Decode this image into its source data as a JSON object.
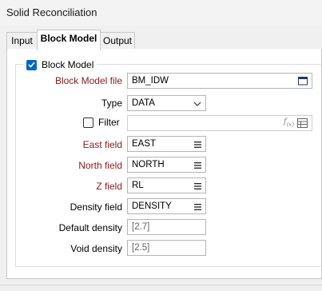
{
  "window": {
    "title": "Solid Reconciliation"
  },
  "tabs": [
    {
      "label": "Input"
    },
    {
      "label": "Block Model"
    },
    {
      "label": "Output"
    }
  ],
  "group": {
    "label": "Block Model",
    "checked": true
  },
  "form": {
    "block_model_file": {
      "label": "Block Model file",
      "value": "BM_IDW"
    },
    "type": {
      "label": "Type",
      "value": "DATA"
    },
    "filter": {
      "label": "Filter",
      "checked": false,
      "value": ""
    },
    "east_field": {
      "label": "East field",
      "value": "EAST"
    },
    "north_field": {
      "label": "North field",
      "value": "NORTH"
    },
    "z_field": {
      "label": "Z field",
      "value": "RL"
    },
    "density_field": {
      "label": "Density field",
      "value": "DENSITY"
    },
    "default_density": {
      "label": "Default density",
      "value": "[2.7]"
    },
    "void_density": {
      "label": "Void density",
      "value": "[2.5]"
    }
  },
  "icons": {
    "file_browse": "calendar-file-icon",
    "dropdown": "chevron-down-icon",
    "list": "list-icon",
    "expression": "fx-icon",
    "filter_table": "table-icon"
  },
  "colors": {
    "accent": "#0067c0",
    "required_label": "#8b1a1a"
  }
}
